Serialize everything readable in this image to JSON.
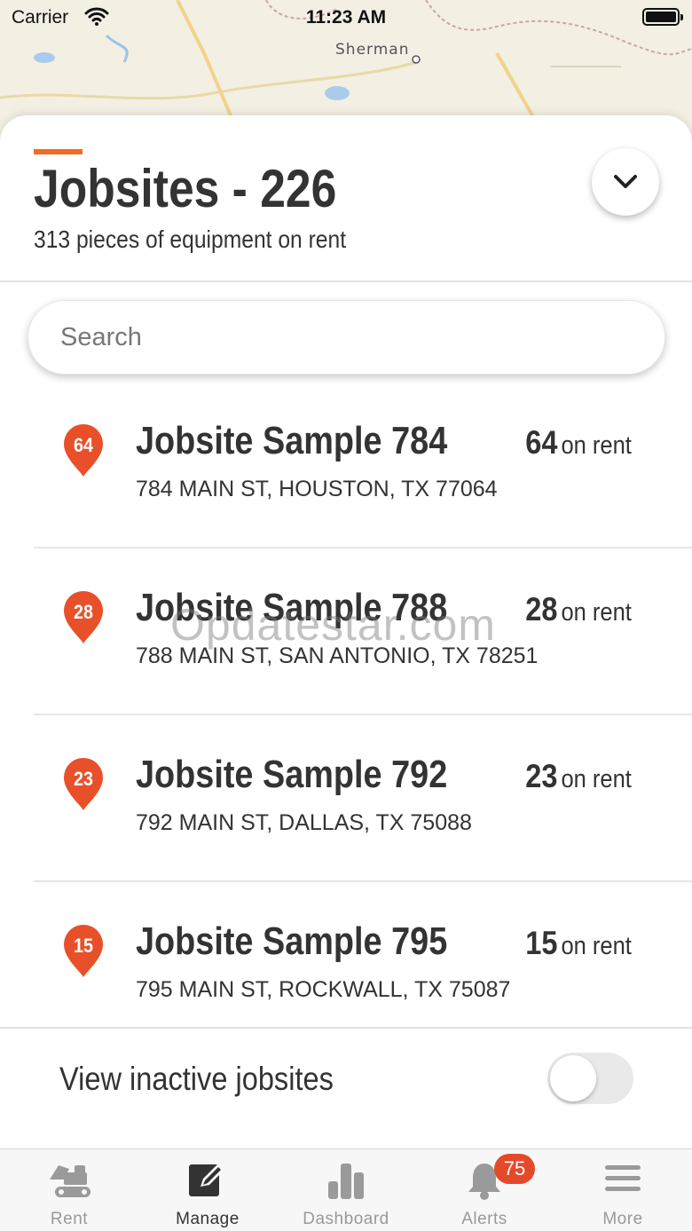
{
  "status_bar": {
    "carrier": "Carrier",
    "time": "11:23 AM"
  },
  "map": {
    "city_label": "Sherman"
  },
  "header": {
    "title": "Jobsites - 226",
    "subtitle": "313 pieces of equipment on rent"
  },
  "search": {
    "placeholder": "Search",
    "value": ""
  },
  "jobsites": [
    {
      "pin": "64",
      "name": "Jobsite Sample 784",
      "address": "784 MAIN ST, HOUSTON, TX 77064",
      "count": "64",
      "count_suffix": "on rent"
    },
    {
      "pin": "28",
      "name": "Jobsite Sample 788",
      "address": "788 MAIN ST, SAN ANTONIO, TX 78251",
      "count": "28",
      "count_suffix": "on rent"
    },
    {
      "pin": "23",
      "name": "Jobsite Sample 792",
      "address": "792 MAIN ST, DALLAS, TX 75088",
      "count": "23",
      "count_suffix": "on rent"
    },
    {
      "pin": "15",
      "name": "Jobsite Sample 795",
      "address": "795 MAIN ST, ROCKWALL, TX 75087",
      "count": "15",
      "count_suffix": "on rent"
    }
  ],
  "inactive_toggle": {
    "label": "View inactive jobsites",
    "on": false
  },
  "watermark": "Opdatestar.com",
  "tabbar": {
    "tabs": [
      {
        "label": "Rent",
        "icon": "excavator-icon",
        "active": false
      },
      {
        "label": "Manage",
        "icon": "edit-icon",
        "active": true
      },
      {
        "label": "Dashboard",
        "icon": "bar-chart-icon",
        "active": false
      },
      {
        "label": "Alerts",
        "icon": "bell-icon",
        "active": false
      },
      {
        "label": "More",
        "icon": "menu-icon",
        "active": false
      }
    ],
    "alerts_badge": "75"
  },
  "colors": {
    "accent": "#f26b21",
    "pin": "#e8502a",
    "badge": "#e44a2a",
    "text": "#333333"
  }
}
